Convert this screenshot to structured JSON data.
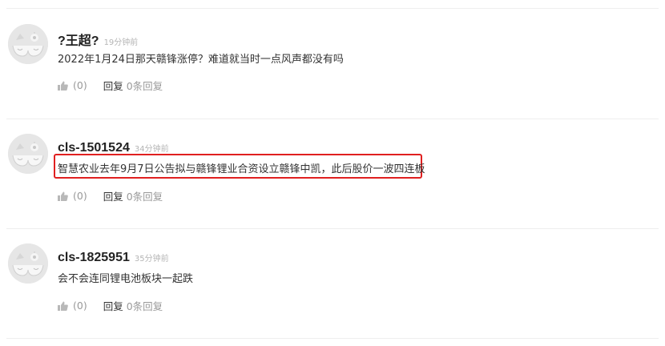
{
  "comments": [
    {
      "username": "?王超?",
      "time": "19分钟前",
      "content": "2022年1月24日那天赣锋涨停？难道就当时一点风声都没有吗",
      "likes": "(0)",
      "reply_label": "回复",
      "reply_count": "0条回复",
      "highlighted": false
    },
    {
      "username": "cls-1501524",
      "time": "34分钟前",
      "content": "智慧农业去年9月7日公告拟与赣锋锂业合资设立赣锋中凯，此后股价一波四连板",
      "likes": "(0)",
      "reply_label": "回复",
      "reply_count": "0条回复",
      "highlighted": true,
      "highlight_color": "#e02020"
    },
    {
      "username": "cls-1825951",
      "time": "35分钟前",
      "content": "会不会连同锂电池板块一起跌",
      "likes": "(0)",
      "reply_label": "回复",
      "reply_count": "0条回复",
      "highlighted": false
    }
  ],
  "icons": {
    "avatar": "default-cat-avatar-icon",
    "like": "thumbs-up-icon"
  }
}
